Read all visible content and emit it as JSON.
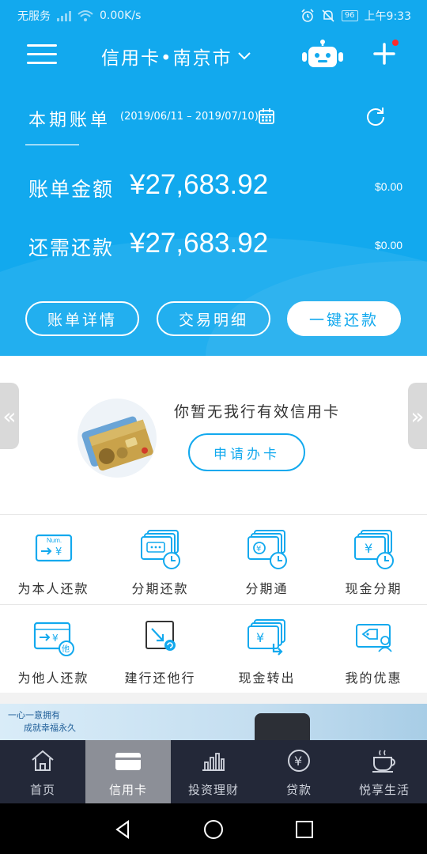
{
  "status_bar": {
    "carrier": "无服务",
    "speed": "0.00K/s",
    "battery": "96",
    "time": "上午9:33"
  },
  "header": {
    "title": "信用卡•南京市",
    "icons": [
      "menu-icon",
      "chevron-down-icon",
      "robot-icon",
      "plus-icon"
    ]
  },
  "statement": {
    "title": "本期账单",
    "range": "(2019/06/11 – 2019/07/10)",
    "bill_label": "账单金额",
    "bill_amount": "¥27,683.92",
    "bill_usd": "$0.00",
    "due_label": "还需还款",
    "due_amount": "¥27,683.92",
    "due_usd": "$0.00"
  },
  "actions": {
    "details": "账单详情",
    "transactions": "交易明细",
    "repay": "一键还款"
  },
  "promo": {
    "text": "你暂无我行有效信用卡",
    "apply": "申请办卡",
    "left_arrow": "«",
    "right_arrow": "»"
  },
  "grid": [
    {
      "label": "为本人还款",
      "icon": "self-repay-icon",
      "mini": "Num."
    },
    {
      "label": "分期还款",
      "icon": "installment-repay-icon"
    },
    {
      "label": "分期通",
      "icon": "installment-pass-icon"
    },
    {
      "label": "现金分期",
      "icon": "cash-installment-icon"
    },
    {
      "label": "为他人还款",
      "icon": "others-repay-icon",
      "mini": "他"
    },
    {
      "label": "建行还他行",
      "icon": "ccb-repay-other-bank-icon"
    },
    {
      "label": "现金转出",
      "icon": "cash-transfer-icon"
    },
    {
      "label": "我的优惠",
      "icon": "my-offers-icon"
    }
  ],
  "banner": {
    "line1": "一心一意拥有",
    "line2": "成就幸福永久"
  },
  "tabs": [
    {
      "label": "首页",
      "icon": "home-icon"
    },
    {
      "label": "信用卡",
      "icon": "credit-card-icon",
      "active": true
    },
    {
      "label": "投资理财",
      "icon": "chart-icon"
    },
    {
      "label": "贷款",
      "icon": "yen-coin-icon"
    },
    {
      "label": "悦享生活",
      "icon": "coffee-cup-icon"
    }
  ],
  "colors": {
    "brand_blue": "#12a9ee",
    "tabbar": "#232838",
    "active_tab": "#8c8f97"
  }
}
